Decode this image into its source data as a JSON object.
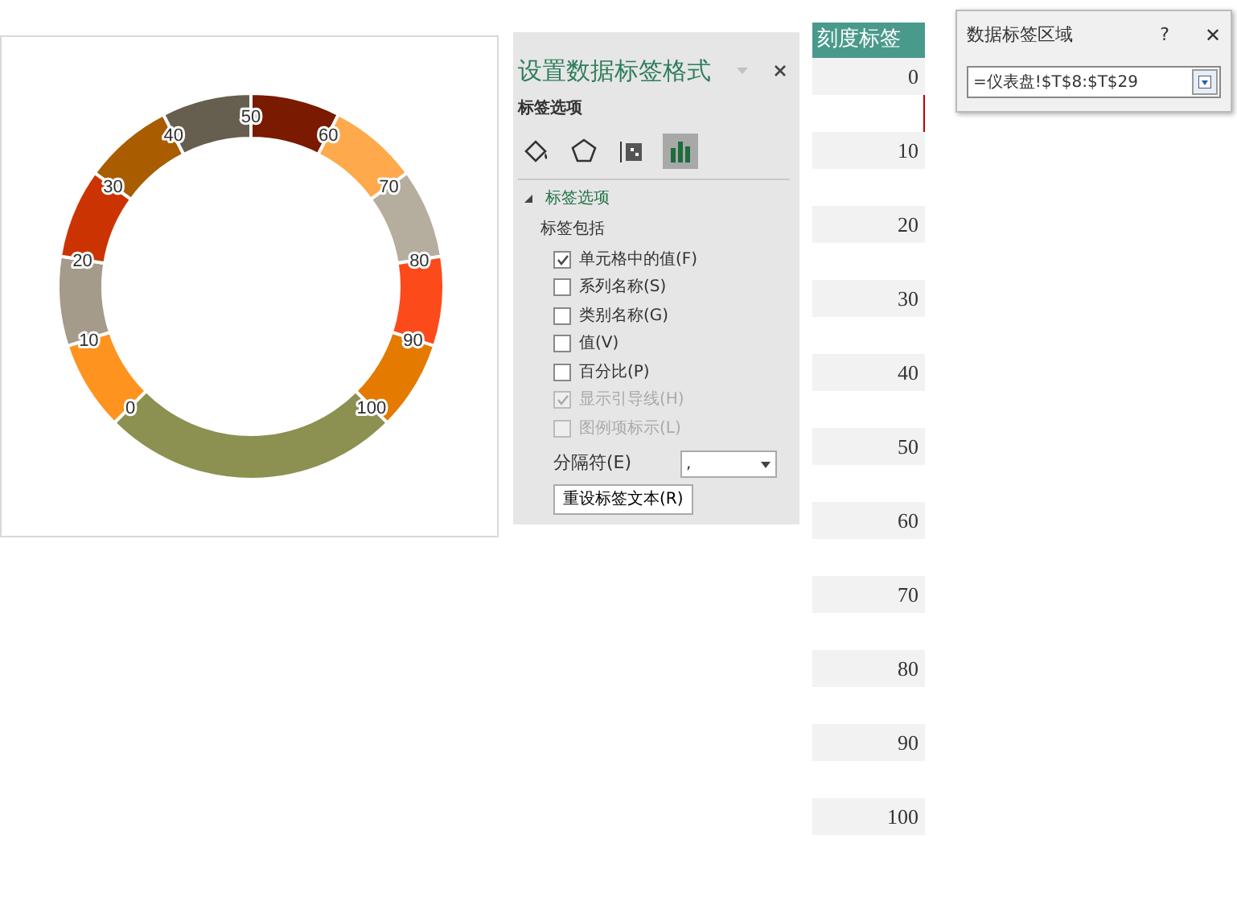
{
  "chart": {
    "segments": [
      {
        "label": "0",
        "color": "#fe9320"
      },
      {
        "label": "10",
        "color": "#a59b8b"
      },
      {
        "label": "20",
        "color": "#cb3402"
      },
      {
        "label": "30",
        "color": "#a95c00"
      },
      {
        "label": "40",
        "color": "#665e4f"
      },
      {
        "label": "50",
        "color": "#7a1a00"
      },
      {
        "label": "60",
        "color": "#ffa94d"
      },
      {
        "label": "70",
        "color": "#b5ad9e"
      },
      {
        "label": "80",
        "color": "#fc4a1a"
      },
      {
        "label": "90",
        "color": "#e47a00"
      },
      {
        "label": "100",
        "color": "#8c9051"
      }
    ]
  },
  "format_pane": {
    "title": "设置数据标签格式",
    "subtitle": "标签选项",
    "icon_tabs": [
      {
        "kind": "fill",
        "selected": false
      },
      {
        "kind": "effects",
        "selected": false
      },
      {
        "kind": "size",
        "selected": false
      },
      {
        "kind": "options",
        "selected": true
      }
    ],
    "section": {
      "title": "标签选项",
      "expanded": true
    },
    "group_label": "标签包括",
    "options": [
      {
        "label": "单元格中的值(F)",
        "checked": true,
        "disabled": false
      },
      {
        "label": "系列名称(S)",
        "checked": false,
        "disabled": false
      },
      {
        "label": "类别名称(G)",
        "checked": false,
        "disabled": false
      },
      {
        "label": "值(V)",
        "checked": false,
        "disabled": false
      },
      {
        "label": "百分比(P)",
        "checked": false,
        "disabled": false
      },
      {
        "label": "显示引导线(H)",
        "checked": true,
        "disabled": true
      },
      {
        "label": "图例项标示(L)",
        "checked": false,
        "disabled": true
      }
    ],
    "separator": {
      "label": "分隔符(E)",
      "value": ","
    },
    "reset_button": "重设标签文本(R)"
  },
  "column": {
    "header": "刻度标签",
    "cells": [
      "0",
      "10",
      "20",
      "30",
      "40",
      "50",
      "60",
      "70",
      "80",
      "90",
      "100"
    ]
  },
  "dialog": {
    "title": "数据标签区域",
    "help": "?",
    "close": "✕",
    "value": "=仪表盘!$T$8:$T$29"
  }
}
